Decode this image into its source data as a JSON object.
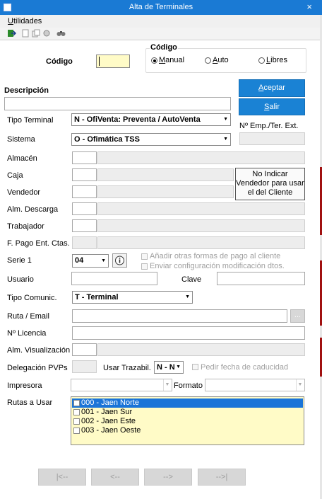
{
  "window": {
    "title": "Alta de Terminales",
    "close_glyph": "×"
  },
  "menu": {
    "utilidades": "Utilidades"
  },
  "toolbar": {
    "icons": [
      "exit-icon",
      "document-icon",
      "copy-icon",
      "tools-icon",
      "binoculars-icon"
    ]
  },
  "codigo": {
    "label": "Código",
    "value": "",
    "group_label": "Código",
    "options": {
      "manual": "Manual",
      "auto": "Auto",
      "libres": "Libres"
    },
    "selected": "Manual"
  },
  "descripcion": {
    "label": "Descripción",
    "value": ""
  },
  "buttons": {
    "aceptar": "Aceptar",
    "salir": "Salir"
  },
  "tipo_terminal": {
    "label": "Tipo Terminal",
    "value": "N - OfiVenta: Preventa / AutoVenta"
  },
  "sistema": {
    "label": "Sistema",
    "value": "O - Ofimática TSS"
  },
  "emp_ter": {
    "label": "Nº Emp./Ter. Ext."
  },
  "almacen": {
    "label": "Almacén"
  },
  "caja": {
    "label": "Caja"
  },
  "no_indicar_vendedor": {
    "label": "No Indicar Vendedor para usar el del Cliente"
  },
  "vendedor": {
    "label": "Vendedor"
  },
  "alm_descarga": {
    "label": "Alm. Descarga"
  },
  "trabajador": {
    "label": "Trabajador"
  },
  "f_pago": {
    "label": "F. Pago Ent. Ctas."
  },
  "serie": {
    "label": "Serie 1",
    "value": "04"
  },
  "checks": {
    "anadir_formas_pago": "Añadir otras formas de pago al cliente",
    "enviar_config": "Enviar configuración modificación dtos."
  },
  "usuario": {
    "label": "Usuario"
  },
  "clave": {
    "label": "Clave"
  },
  "tipo_comunic": {
    "label": "Tipo Comunic.",
    "value": "T - Terminal"
  },
  "ruta_email": {
    "label": "Ruta / Email",
    "browse": "..."
  },
  "licencia": {
    "label": "Nº Licencia"
  },
  "alm_visualizacion": {
    "label": "Alm. Visualización"
  },
  "delegacion": {
    "label": "Delegación PVPs"
  },
  "usar_trazabil": {
    "label": "Usar Trazabil.",
    "value": "N - N"
  },
  "pedir_fecha": {
    "label": "Pedir fecha de caducidad"
  },
  "impresora": {
    "label": "Impresora"
  },
  "formato": {
    "label": "Formato"
  },
  "rutas": {
    "label": "Rutas a Usar",
    "items": [
      {
        "label": "000 - Jaen Norte",
        "selected": true
      },
      {
        "label": "001 - Jaen Sur",
        "selected": false
      },
      {
        "label": "002 - Jaen Este",
        "selected": false
      },
      {
        "label": "003 - Jaen Oeste",
        "selected": false
      }
    ]
  },
  "nav": {
    "first": "|<--",
    "prev": "<--",
    "next": "-->",
    "last": "-->|"
  },
  "colors": {
    "titlebar": "#1a7ad4",
    "accent_button": "#1a82d4",
    "list_bg": "#fffbc7",
    "list_selected": "#1a74d8"
  }
}
